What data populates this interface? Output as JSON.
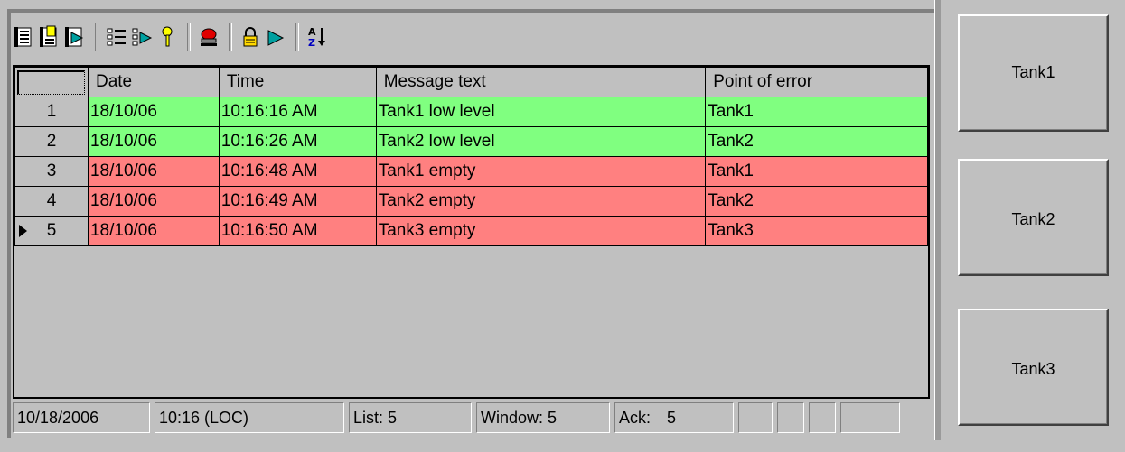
{
  "toolbar": {
    "icons": [
      "message-view-icon",
      "message-list-icon",
      "history-list-icon",
      "list-settings-icon",
      "filter-icon",
      "acknowledge-icon",
      "alarm-bell-icon",
      "lock-icon",
      "hide-icon",
      "sort-icon"
    ]
  },
  "table": {
    "headers": [
      "Date",
      "Time",
      "Message text",
      "Point of error"
    ],
    "rows": [
      {
        "num": "1",
        "date": "18/10/06",
        "time": "10:16:16 AM",
        "message": "Tank1 low level",
        "point": "Tank1",
        "status": "green"
      },
      {
        "num": "2",
        "date": "18/10/06",
        "time": "10:16:26 AM",
        "message": "Tank2 low level",
        "point": "Tank2",
        "status": "green"
      },
      {
        "num": "3",
        "date": "18/10/06",
        "time": "10:16:48 AM",
        "message": "Tank1 empty",
        "point": "Tank1",
        "status": "red"
      },
      {
        "num": "4",
        "date": "18/10/06",
        "time": "10:16:49 AM",
        "message": "Tank2 empty",
        "point": "Tank2",
        "status": "red"
      },
      {
        "num": "5",
        "date": "18/10/06",
        "time": "10:16:50 AM",
        "message": "Tank3 empty",
        "point": "Tank3",
        "status": "red"
      }
    ]
  },
  "status": {
    "date": "10/18/2006",
    "time": "10:16 (LOC)",
    "list": "List: 5",
    "window": "Window: 5",
    "ack_label": "Ack:",
    "ack_value": "5"
  },
  "buttons": {
    "tank1": "Tank1",
    "tank2": "Tank2",
    "tank3": "Tank3"
  },
  "colors": {
    "green": "#80ff80",
    "red": "#ff8080",
    "background": "#c0c0c0"
  }
}
